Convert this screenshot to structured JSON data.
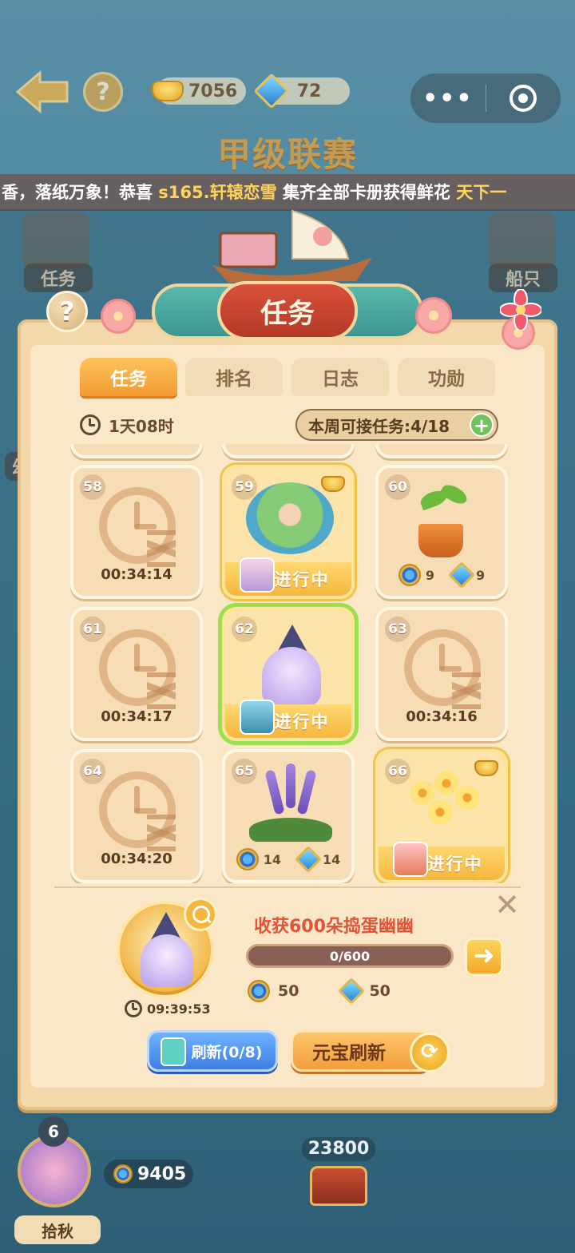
{
  "top_bar": {
    "gold": "7056",
    "gems": "72",
    "help": "?",
    "capsule_dots": "•••"
  },
  "league_title": "甲级联赛",
  "ticker": {
    "prefix": "香，落纸万象！恭喜",
    "player": " s165.轩辕恋雪 ",
    "middle": "集齐全部卡册获得鲜花",
    "suffix": " 天下一"
  },
  "background": {
    "left_label": "任务",
    "right_label": "船只",
    "side_label": "幼"
  },
  "modal": {
    "title": "任务",
    "help": "?",
    "tabs": [
      {
        "label": "任务",
        "active": true
      },
      {
        "label": "排名",
        "active": false
      },
      {
        "label": "日志",
        "active": false
      },
      {
        "label": "功勋",
        "active": false
      }
    ],
    "time_left": "1天08时",
    "weekly": "本周可接任务:4/18",
    "plus": "+",
    "cards": [
      {
        "num": "58",
        "type": "timer",
        "time": "00:34:14"
      },
      {
        "num": "59",
        "type": "in_progress",
        "status": "进行中",
        "illustration": "garden",
        "ingot": true
      },
      {
        "num": "60",
        "type": "reward",
        "illustration": "sprout",
        "compass": "9",
        "diamond": "9"
      },
      {
        "num": "61",
        "type": "timer",
        "time": "00:34:17"
      },
      {
        "num": "62",
        "type": "in_progress",
        "status": "进行中",
        "illustration": "ghost",
        "selected": true
      },
      {
        "num": "63",
        "type": "timer",
        "time": "00:34:16"
      },
      {
        "num": "64",
        "type": "timer",
        "time": "00:34:20"
      },
      {
        "num": "65",
        "type": "reward",
        "illustration": "lavender",
        "compass": "14",
        "diamond": "14"
      },
      {
        "num": "66",
        "type": "in_progress",
        "status": "进行中",
        "illustration": "yellow-flowers",
        "ingot": true
      }
    ],
    "detail": {
      "title": "收获600朵捣蛋幽幽",
      "progress_text": "0/600",
      "progress_fraction": 0,
      "timer": "09:39:53",
      "compass_reward": "50",
      "diamond_reward": "50",
      "close": "✕",
      "go": "➜"
    },
    "refresh_button": "刷新(0/8)",
    "yuanbao_refresh_button": "元宝刷新",
    "refresh_icon": "⟳"
  },
  "bottom": {
    "level": "6",
    "name": "拾秋",
    "coins": "9405",
    "score": "23800"
  }
}
